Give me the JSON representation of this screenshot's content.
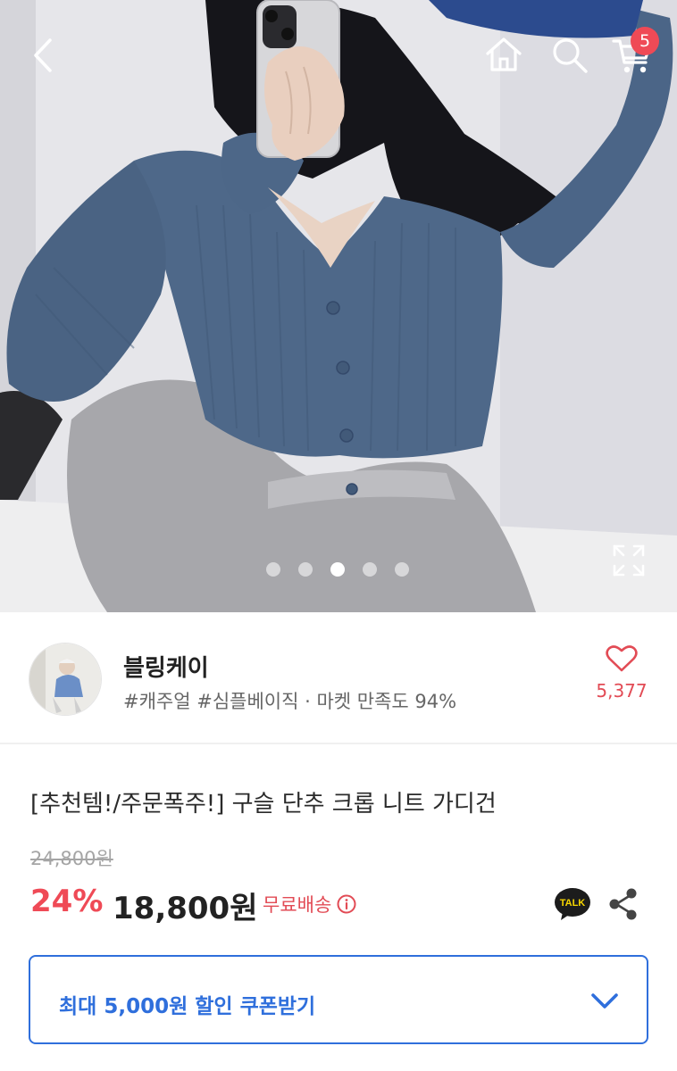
{
  "header": {
    "icons": [
      "back-arrow-icon",
      "home-icon",
      "search-icon",
      "cart-icon"
    ],
    "cart_count": "5"
  },
  "gallery": {
    "total_images": 5,
    "active_index": 2
  },
  "shop": {
    "name": "블링케이",
    "tags": "#캐주얼 #심플베이직 · 마켓 만족도 94%",
    "like_count": "5,377"
  },
  "product": {
    "title": "[추천템!/주문폭주!] 구슬 단추 크롭 니트 가디건",
    "original_price": "24,800원",
    "discount": "24%",
    "price": "18,800원",
    "shipping": "무료배송"
  },
  "talk": {
    "label": "TALK"
  },
  "coupon": {
    "label": "최대 5,000원 할인 쿠폰받기"
  },
  "colors": {
    "accent_red": "#ef4a56",
    "accent_blue": "#2f6fdc",
    "cardigan": "#4e6889"
  }
}
